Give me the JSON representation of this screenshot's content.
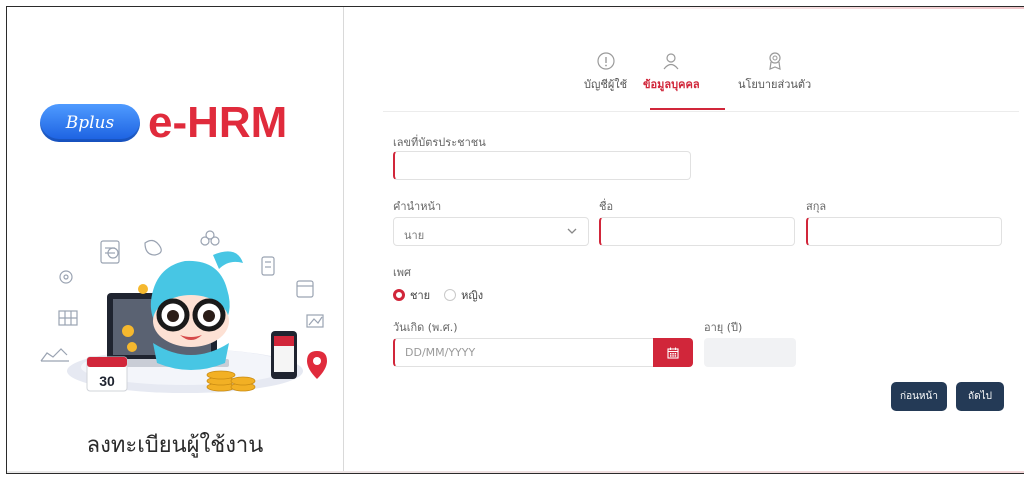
{
  "brand": {
    "pill_text": "Bplus",
    "product_name": "e-HRM",
    "accent_color": "#e02b3c",
    "pill_color": "#2a72ea"
  },
  "left_panel": {
    "title": "ลงทะเบียนผู้ใช้งาน",
    "illustration_calendar_number": "30"
  },
  "steps": [
    {
      "label": "บัญชีผู้ใช้",
      "icon": "info-icon",
      "active": false
    },
    {
      "label": "ข้อมูลบุคคล",
      "icon": "user-icon",
      "active": true
    },
    {
      "label": "นโยบายส่วนตัว",
      "icon": "award-icon",
      "active": false
    }
  ],
  "form": {
    "id_card": {
      "label": "เลขที่บัตรประชาชน",
      "value": ""
    },
    "prefix": {
      "label": "คำนำหน้า",
      "value": "นาย",
      "options_visible": [
        "นาย"
      ]
    },
    "first_name": {
      "label": "ชื่อ",
      "value": ""
    },
    "last_name": {
      "label": "สกุล",
      "value": ""
    },
    "gender": {
      "label": "เพศ",
      "options": [
        {
          "label": "ชาย",
          "selected": true
        },
        {
          "label": "หญิง",
          "selected": false
        }
      ]
    },
    "birth_date": {
      "label": "วันเกิด (พ.ศ.)",
      "placeholder": "DD/MM/YYYY",
      "value": ""
    },
    "age": {
      "label": "อายุ (ปี)",
      "value": ""
    }
  },
  "buttons": {
    "back": "ก่อนหน้า",
    "next": "ถัดไป"
  },
  "colors": {
    "required_marker": "#d1263a",
    "button_bg": "#243a56",
    "calendar_button": "#d1263a"
  }
}
